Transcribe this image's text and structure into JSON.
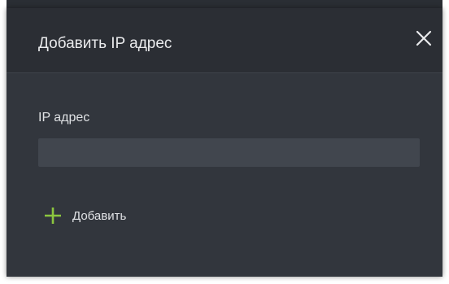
{
  "dialog": {
    "title": "Добавить IP адрес",
    "close_icon": "close-icon"
  },
  "form": {
    "ip_label": "IP адрес",
    "ip_value": "",
    "ip_placeholder": ""
  },
  "actions": {
    "add_label": "Добавить",
    "add_icon": "plus-icon"
  },
  "colors": {
    "header_background": "#2b2e34",
    "body_background": "#32363d",
    "input_background": "#41464e",
    "text": "#e9eaec",
    "accent_green": "#8cc63f"
  }
}
